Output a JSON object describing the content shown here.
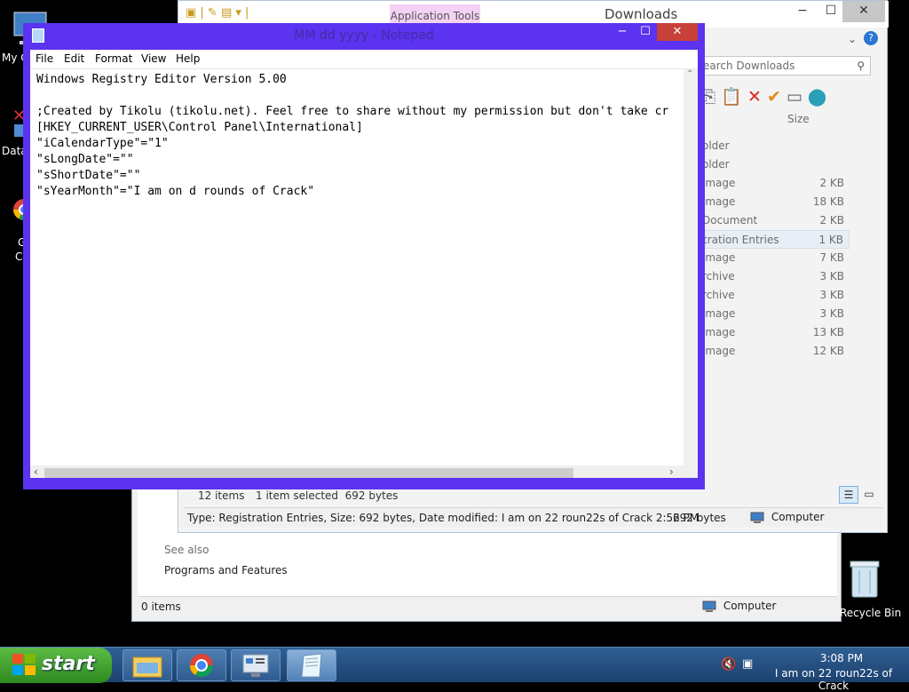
{
  "desktop": {
    "icons": [
      {
        "label": "My C",
        "icon": "computer-icon"
      },
      {
        "label": "Data",
        "icon": "data-icon"
      },
      {
        "label": "G",
        "label2": "C",
        "icon": "chrome-icon"
      },
      {
        "label": "Recycle Bin",
        "icon": "recycle-bin-icon"
      }
    ]
  },
  "control_panel": {
    "see_also": "See also",
    "programs_link": "Programs and Features",
    "status_items": "0 items",
    "status_location": "Computer"
  },
  "downloads": {
    "title": "Downloads",
    "app_tools_tab": "Application Tools",
    "search_placeholder": "earch Downloads",
    "size_header": "Size",
    "rows": [
      {
        "type": "older",
        "size": ""
      },
      {
        "type": "older",
        "size": ""
      },
      {
        "type": "image",
        "size": "2 KB"
      },
      {
        "type": "image",
        "size": "18 KB"
      },
      {
        "type": "Document",
        "size": "2 KB"
      },
      {
        "type": "tration Entries",
        "size": "1 KB",
        "selected": true
      },
      {
        "type": "image",
        "size": "7 KB"
      },
      {
        "type": "rchive",
        "size": "3 KB"
      },
      {
        "type": "rchive",
        "size": "3 KB"
      },
      {
        "type": "image",
        "size": "3 KB"
      },
      {
        "type": "image",
        "size": "13 KB"
      },
      {
        "type": "image",
        "size": "12 KB"
      }
    ],
    "items_count": "12 items",
    "selection_info": "1 item selected  692 bytes",
    "status_details": "Type: Registration Entries, Size: 692 bytes, Date modified: I am on 22 roun22s of Crack 2:52 PM",
    "status_size": "692 bytes",
    "status_location": "Computer"
  },
  "notepad": {
    "title": "MM dd yyyy - Notepad",
    "menu": [
      "File",
      "Edit",
      "Format",
      "View",
      "Help"
    ],
    "content": "Windows Registry Editor Version 5.00\n\n;Created by Tikolu (tikolu.net). Feel free to share without my permission but don't take cr\n[HKEY_CURRENT_USER\\Control Panel\\International]\n\"iCalendarType\"=\"1\"\n\"sLongDate\"=\"\"\n\"sShortDate\"=\"\"\n\"sYearMonth\"=\"I am on d rounds of Crack\""
  },
  "taskbar": {
    "start_label": "start",
    "apps": [
      "file-explorer-icon",
      "chrome-icon",
      "control-panel-icon",
      "notepad-icon"
    ],
    "clock_time": "3:08 PM",
    "clock_date": "I am on 22 roun22s of Crack"
  },
  "colors": {
    "notepad_frame": "#5b33f0",
    "close_button": "#c7413a",
    "taskbar": "#2f5f93",
    "start": "#4aa83a"
  }
}
